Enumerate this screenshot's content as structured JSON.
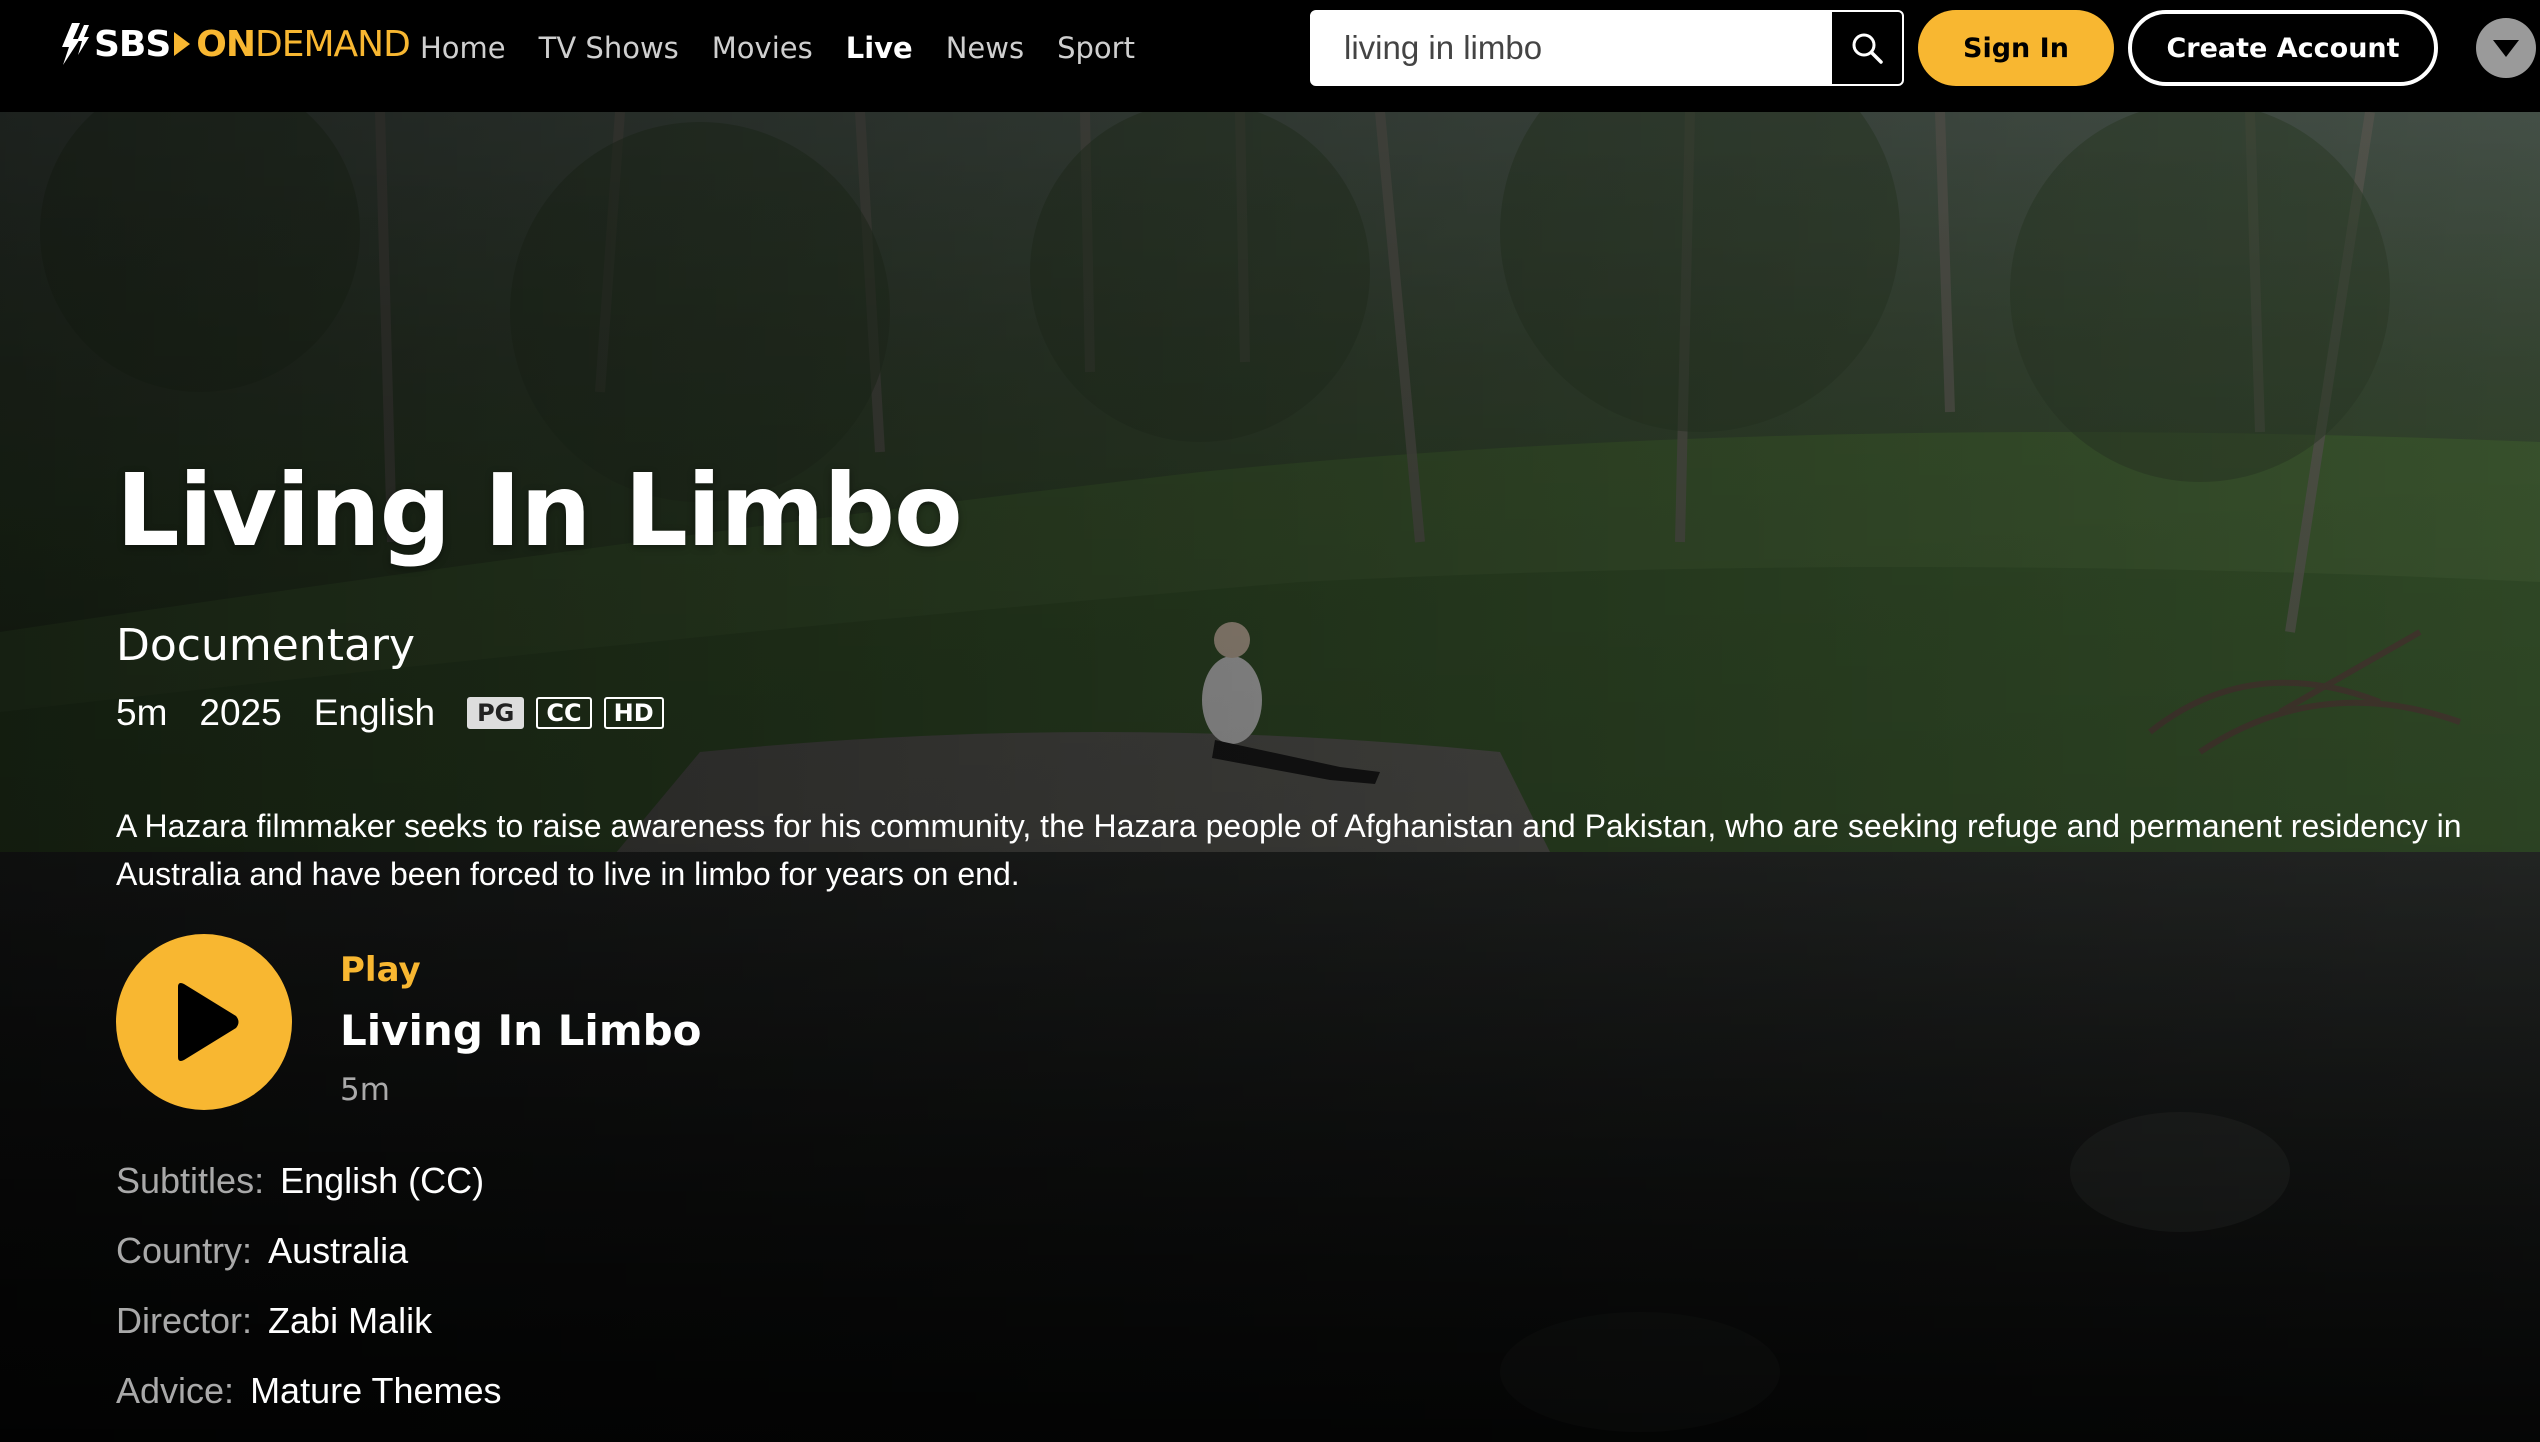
{
  "brand": {
    "sbs": "SBS",
    "on": "ON",
    "demand": "DEMAND",
    "accent_color": "#f8b731"
  },
  "nav": {
    "items": [
      {
        "label": "Home",
        "active": false
      },
      {
        "label": "TV Shows",
        "active": false
      },
      {
        "label": "Movies",
        "active": false
      },
      {
        "label": "Live",
        "active": true
      },
      {
        "label": "News",
        "active": false
      },
      {
        "label": "Sport",
        "active": false
      }
    ]
  },
  "search": {
    "value": "living in limbo",
    "icon": "search-icon"
  },
  "auth": {
    "sign_in": "Sign In",
    "create_account": "Create Account"
  },
  "profile": {
    "icon": "chevron-down-icon"
  },
  "program": {
    "title": "Living In Limbo",
    "genre": "Documentary",
    "duration": "5m",
    "year": "2025",
    "language": "English",
    "badges": [
      "PG",
      "CC",
      "HD"
    ],
    "description": "A Hazara filmmaker seeks to raise awareness for his community, the Hazara people of Afghanistan and Pakistan, who are seeking refuge and permanent residency in Australia and have been forced to live in limbo for years on end."
  },
  "play": {
    "label": "Play",
    "episode_title": "Living In Limbo",
    "duration": "5m",
    "icon": "play-icon"
  },
  "details": [
    {
      "key": "Subtitles:",
      "value": "English (CC)"
    },
    {
      "key": "Country:",
      "value": "Australia"
    },
    {
      "key": "Director:",
      "value": "Zabi Malik"
    },
    {
      "key": "Advice:",
      "value": "Mature Themes"
    }
  ]
}
